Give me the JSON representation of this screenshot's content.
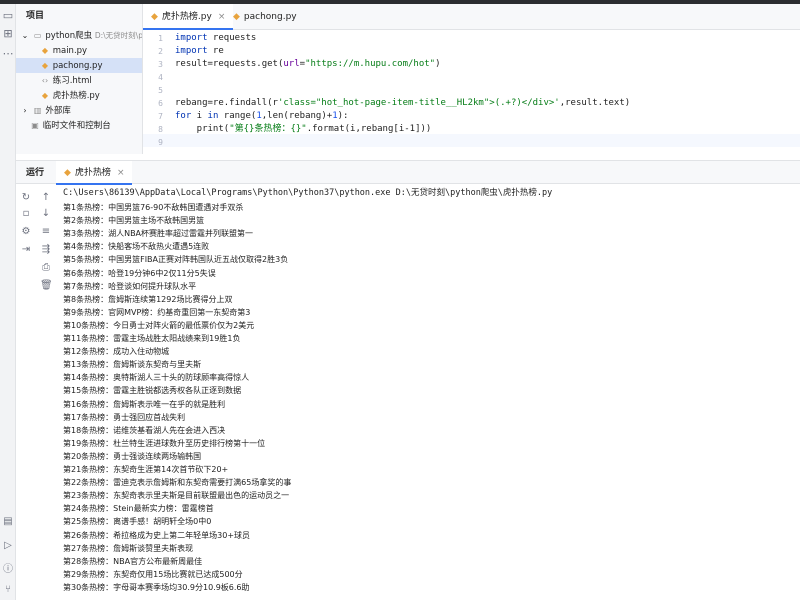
{
  "project": {
    "title": "项目",
    "root_name": "python爬虫",
    "root_path": "D:\\无贷时刻\\py",
    "files": [
      "main.py",
      "pachong.py",
      "练习.html",
      "虎扑热榜.py"
    ],
    "external": "外部库",
    "scratch": "临时文件和控制台"
  },
  "tabs": [
    {
      "label": "虎扑热榜.py",
      "close": "×"
    },
    {
      "label": "pachong.py",
      "close": ""
    }
  ],
  "editor": {
    "line_numbers": [
      "1",
      "2",
      "3",
      "4",
      "5",
      "6",
      "7",
      "8",
      "9"
    ],
    "lines": [
      [
        [
          "kw",
          "import"
        ],
        [
          "fn",
          " requests"
        ]
      ],
      [
        [
          "kw",
          "import"
        ],
        [
          "fn",
          " re"
        ]
      ],
      [
        [
          "fn",
          "result=requests.get("
        ],
        [
          "param",
          "url"
        ],
        [
          "fn",
          "="
        ],
        [
          "str",
          "\"https://m.hupu.com/hot\""
        ],
        [
          "fn",
          ")"
        ]
      ],
      [],
      [],
      [
        [
          "fn",
          "rebang=re.findall(r"
        ],
        [
          "str",
          "'class=\"hot_hot-page-item-title__HL2km\">(.+?)</div>'"
        ],
        [
          "fn",
          ",result.text)"
        ]
      ],
      [
        [
          "kw",
          "for"
        ],
        [
          "fn",
          " i "
        ],
        [
          "kw",
          "in"
        ],
        [
          "fn",
          " range("
        ],
        [
          "num",
          "1"
        ],
        [
          "fn",
          ",len(rebang)+"
        ],
        [
          "num",
          "1"
        ],
        [
          "fn",
          "):"
        ]
      ],
      [
        [
          "fn",
          "    print("
        ],
        [
          "str",
          "\"第{}条热榜：{}\""
        ],
        [
          "fn",
          ".format(i,rebang[i-1]))"
        ]
      ],
      []
    ]
  },
  "run": {
    "label": "运行",
    "tab": "虎扑热榜",
    "command": "C:\\Users\\86139\\AppData\\Local\\Programs\\Python\\Python37\\python.exe D:\\无贷时刻\\python爬虫\\虎扑热榜.py",
    "output": [
      "第1条热榜：中国男篮76-90不敌韩国遭遇对手双杀",
      "第2条热榜：中国男篮主场不敌韩国男篮",
      "第3条热榜：湖人NBA杯赛胜率超过雷霆并列联盟第一",
      "第4条热榜：快船客场不敌热火遭遇5连败",
      "第5条热榜：中国男篮FIBA正赛对阵韩国队近五战仅取得2胜3负",
      "第6条热榜：哈登19分钟6中2仅11分5失误",
      "第7条热榜：哈登谈如何提升球队水平",
      "第8条热榜：詹姆斯连续第1292场比赛得分上双",
      "第9条热榜：官网MVP榜：约基奇重回第一东契奇第3",
      "第10条热榜：今日勇士对阵火箭的最低票价仅为2美元",
      "第11条热榜：雷霆主场战胜太阳战绩来到19胜1负",
      "第12条热榜：成功入住动物城",
      "第13条热榜：詹姆斯谈东契奇与里夫斯",
      "第14条热榜：奥特斯湖人三十头的防球顾率高得惊人",
      "第15条热榜：雷霆主胜锐都选秀权各队正逐到数据",
      "第16条热榜：詹姆斯表示唯一在乎的就是胜利",
      "第17条热榜：勇士强回应首战失利",
      "第18条热榜：诺维茨基看湖人先在会进入西决",
      "第19条热榜：杜兰特生涯进球数升至历史排行榜第十一位",
      "第20条热榜：勇士强谈连续两场输韩国",
      "第21条热榜：东契奇生涯第14次首节砍下20+",
      "第22条热榜：雷迪克表示詹姆斯和东契奇需要打满65场拿奖的事",
      "第23条热榜：东契奇表示里夫斯是目前联盟最出色的运动员之一",
      "第24条热榜：Stein最新实力榜：雷霆榜首",
      "第25条热榜：离谱手感！胡明轩全场0中0",
      "第26条热榜：希拉格成为史上第二年轻单场30+球员",
      "第27条热榜：詹姆斯谈赞里夫斯表现",
      "第28条热榜：NBA官方公布最新周最佳",
      "第29条热榜：东契奇仅用15场比赛就已达成500分",
      "第30条热榜：字母哥本赛季场均30.9分10.9板6.6助"
    ]
  }
}
